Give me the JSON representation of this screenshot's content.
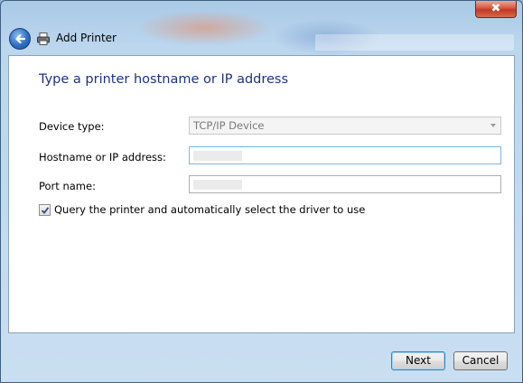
{
  "window": {
    "close_glyph": "✖"
  },
  "nav": {
    "title": "Add Printer",
    "back_icon": "back-arrow-icon",
    "printer_icon": "printer-icon"
  },
  "page": {
    "heading": "Type a printer hostname or IP address",
    "device_type": {
      "label": "Device type:",
      "value": "TCP/IP Device"
    },
    "hostname": {
      "label": "Hostname or IP address:"
    },
    "port": {
      "label": "Port name:"
    },
    "query_checkbox": {
      "label": "Query the printer and automatically select the driver to use",
      "checked": true
    }
  },
  "footer": {
    "next_label": "Next",
    "cancel_label": "Cancel"
  },
  "colors": {
    "heading": "#1e3287",
    "accent": "#3c7fb1"
  }
}
